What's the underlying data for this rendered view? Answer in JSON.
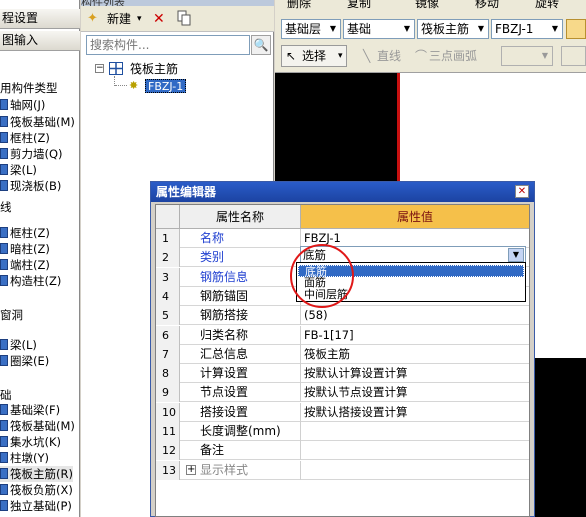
{
  "left_nav": {
    "headers": [
      "程设置",
      "图输入"
    ],
    "items": [
      {
        "label": "用构件类型",
        "icon": false
      },
      {
        "label": "轴网(J)",
        "icon": true
      },
      {
        "label": "筏板基础(M)",
        "icon": true
      },
      {
        "label": "框柱(Z)",
        "icon": true
      },
      {
        "label": "剪力墙(Q)",
        "icon": true
      },
      {
        "label": "梁(L)",
        "icon": true
      },
      {
        "label": "现浇板(B)",
        "icon": true
      },
      {
        "label": "线",
        "icon": false
      },
      {
        "label": "框柱(Z)",
        "icon": true
      },
      {
        "label": "暗柱(Z)",
        "icon": true
      },
      {
        "label": "端柱(Z)",
        "icon": true
      },
      {
        "label": "构造柱(Z)",
        "icon": true
      },
      {
        "label": "窗洞",
        "icon": false
      },
      {
        "label": "梁(L)",
        "icon": true
      },
      {
        "label": "圈梁(E)",
        "icon": true
      },
      {
        "label": "础",
        "icon": false
      },
      {
        "label": "基础梁(F)",
        "icon": true
      },
      {
        "label": "筏板基础(M)",
        "icon": true
      },
      {
        "label": "集水坑(K)",
        "icon": true
      },
      {
        "label": "柱墩(Y)",
        "icon": true
      },
      {
        "label": "筏板主筋(R)",
        "icon": true
      },
      {
        "label": "筏板负筋(X)",
        "icon": true
      },
      {
        "label": "独立基础(P)",
        "icon": true
      }
    ]
  },
  "component_panel": {
    "title": "构件列表",
    "new_label": "新建",
    "delete_icon": "delete-x-icon",
    "copy_icon": "copy-icon",
    "search_placeholder": "搜索构件...",
    "tree_root": "筏板主筋",
    "tree_child": "FBZJ-1"
  },
  "top_toolbar": {
    "row1": [
      "删除",
      "复制",
      "镜像",
      "移动",
      "旋转"
    ],
    "floor": "基础层",
    "category": "基础",
    "type": "筏板主筋",
    "component": "FBZJ-1",
    "select_label": "选择",
    "line_label": "直线",
    "arc_label": "三点画弧"
  },
  "dialog": {
    "title": "属性编辑器",
    "col_name": "属性名称",
    "col_value": "属性值",
    "rows": [
      {
        "n": "1",
        "name": "名称",
        "value": "FBZJ-1",
        "style": "blue"
      },
      {
        "n": "2",
        "name": "类别",
        "value": "底筋",
        "style": "blue"
      },
      {
        "n": "3",
        "name": "钢筋信息",
        "value": "",
        "style": "blue"
      },
      {
        "n": "4",
        "name": "钢筋锚固",
        "value": "",
        "style": "normal"
      },
      {
        "n": "5",
        "name": "钢筋搭接",
        "value": "(58)",
        "style": "normal"
      },
      {
        "n": "6",
        "name": "归类名称",
        "value": "FB-1[17]",
        "style": "normal"
      },
      {
        "n": "7",
        "name": "汇总信息",
        "value": "筏板主筋",
        "style": "normal"
      },
      {
        "n": "8",
        "name": "计算设置",
        "value": "按默认计算设置计算",
        "style": "normal"
      },
      {
        "n": "9",
        "name": "节点设置",
        "value": "按默认节点设置计算",
        "style": "normal"
      },
      {
        "n": "10",
        "name": "搭接设置",
        "value": "按默认搭接设置计算",
        "style": "normal"
      },
      {
        "n": "11",
        "name": "长度调整(mm)",
        "value": "",
        "style": "normal"
      },
      {
        "n": "12",
        "name": "备注",
        "value": "",
        "style": "normal"
      },
      {
        "n": "13",
        "name": "显示样式",
        "value": "",
        "style": "grey"
      }
    ],
    "dropdown_options": [
      "底筋",
      "面筋",
      "中间层筋"
    ],
    "selected_option": "底筋"
  },
  "colors": {
    "label_blue": "#1f3fd0",
    "header_value_bg": "#f5c04a",
    "title_bar": "#1c43a2",
    "highlight_circle": "#e01818",
    "selection": "#316ac5"
  }
}
